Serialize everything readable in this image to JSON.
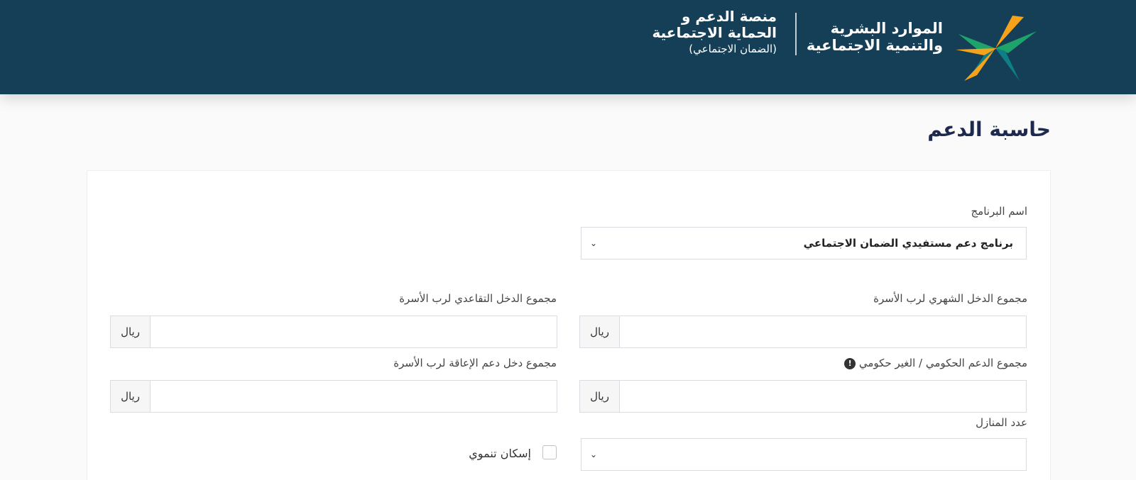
{
  "header": {
    "ministry_line1": "الموارد البشرية",
    "ministry_line2": "والتنمية الاجتماعية",
    "platform_line1": "منصة الدعم و",
    "platform_line2": "الحماية الاجتماعية",
    "platform_line3": "(الضمان الاجتماعي)",
    "colors": {
      "background": "#153f57",
      "logo_orange": "#f7a21b",
      "logo_green": "#1ea36b",
      "logo_teal": "#0f7f86"
    }
  },
  "page": {
    "title": "حاسبة الدعم"
  },
  "form": {
    "program_label": "اسم البرنامج",
    "program_value": "برنامج دعم مستفيدي الضمان الاجتماعي",
    "monthly_income_label": "مجموع الدخل الشهري لرب الأسرة",
    "retirement_income_label": "مجموع الدخل التقاعدي لرب الأسرة",
    "gov_support_label": "مجموع الدعم الحكومي / الغير حكومي",
    "disability_income_label": "مجموع دخل دعم الإعاقة لرب الأسرة",
    "homes_count_label": "عدد المنازل",
    "homes_count_value": "",
    "dev_housing_label": "إسكان تنموي",
    "currency": "ريال",
    "info_icon_glyph": "!"
  }
}
